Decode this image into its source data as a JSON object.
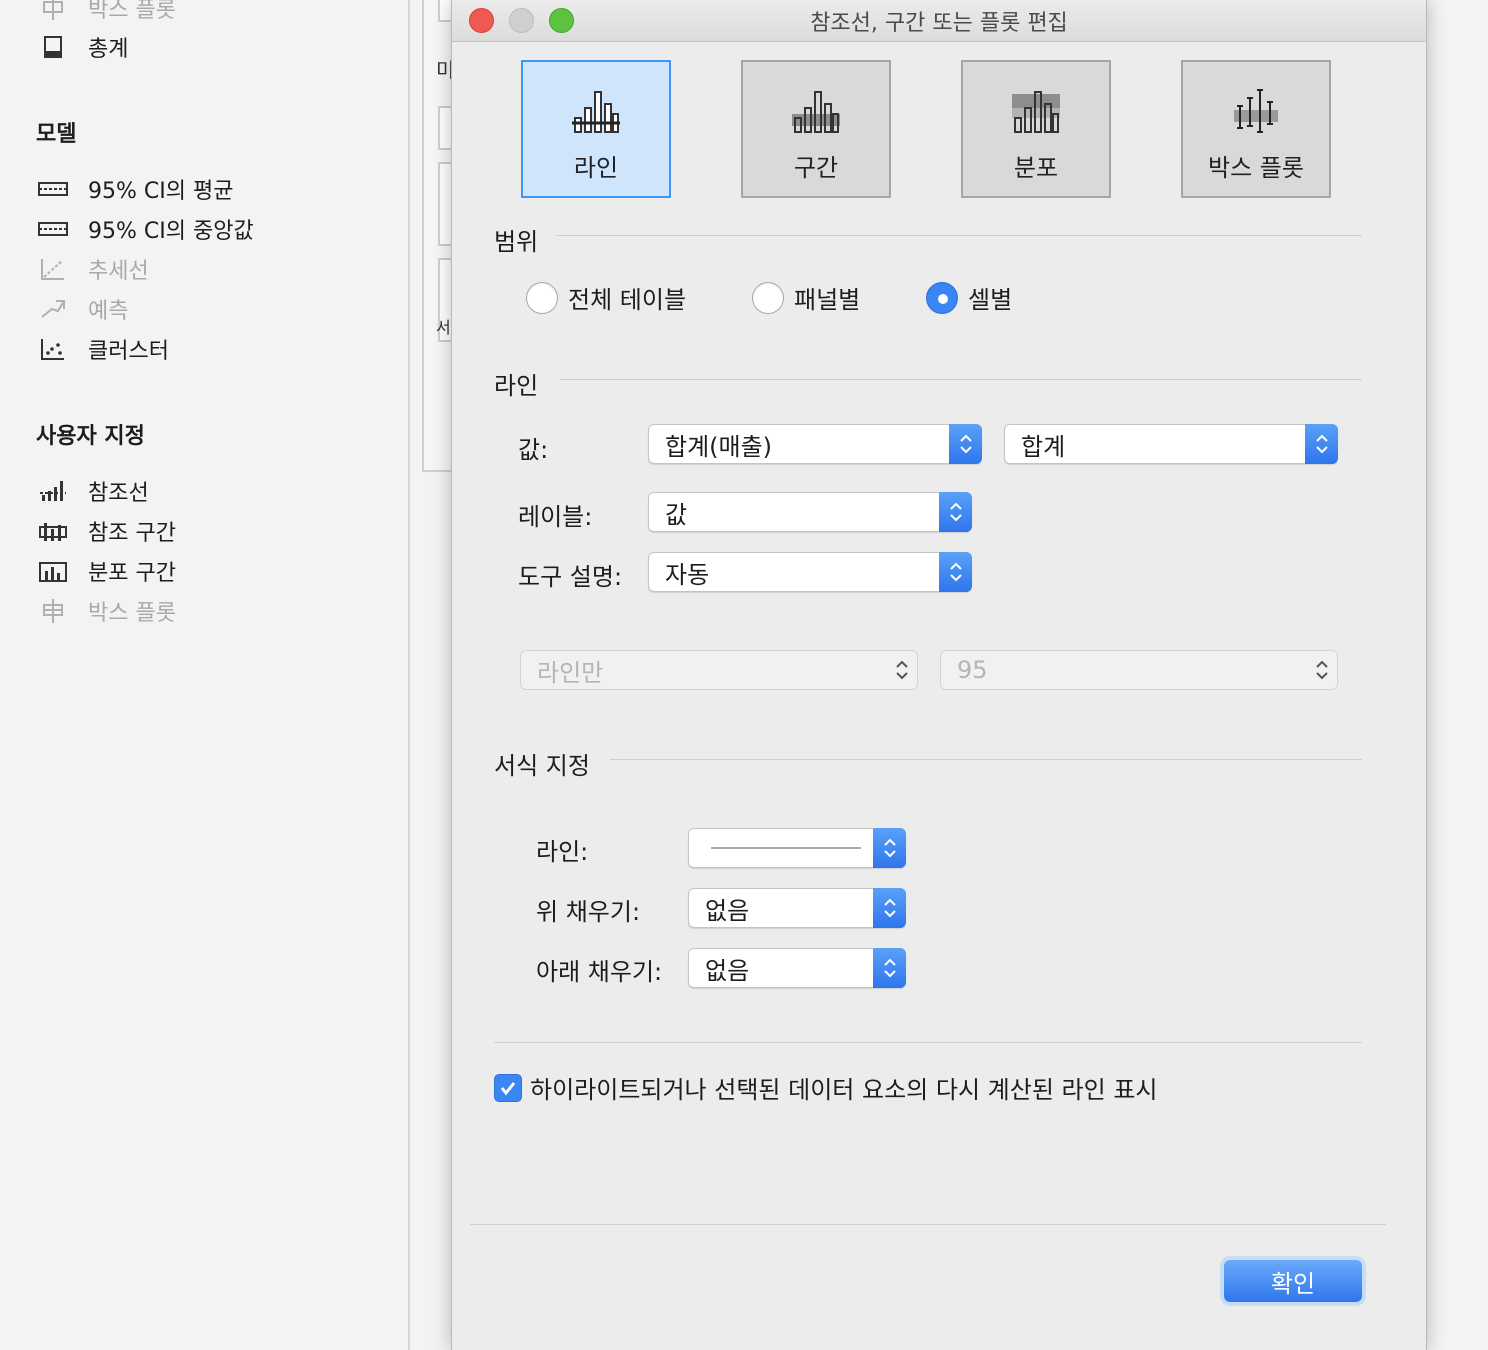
{
  "left_pane": {
    "top_partial_item": "박스 플롯",
    "top_item": "총계",
    "model": {
      "title": "모델",
      "items": [
        {
          "label": "95% CI의 평균",
          "icon": "ci-band-icon",
          "enabled": true
        },
        {
          "label": "95% CI의 중앙값",
          "icon": "ci-band-icon",
          "enabled": true
        },
        {
          "label": "추세선",
          "icon": "trend-line-icon",
          "enabled": false
        },
        {
          "label": "예측",
          "icon": "forecast-icon",
          "enabled": false
        },
        {
          "label": "클러스터",
          "icon": "cluster-icon",
          "enabled": true
        }
      ]
    },
    "custom": {
      "title": "사용자 지정",
      "items": [
        {
          "label": "참조선",
          "icon": "reference-line-icon",
          "enabled": true
        },
        {
          "label": "참조 구간",
          "icon": "reference-band-icon",
          "enabled": true
        },
        {
          "label": "분포 구간",
          "icon": "distribution-band-icon",
          "enabled": true
        },
        {
          "label": "박스 플롯",
          "icon": "box-plot-icon",
          "enabled": false
        }
      ]
    }
  },
  "behind_window": {
    "fragment_top": "미",
    "fragment_mid": "서"
  },
  "dialog": {
    "title": "참조선, 구간 또는 플롯 편집",
    "type_buttons": [
      {
        "label": "라인",
        "selected": true
      },
      {
        "label": "구간",
        "selected": false
      },
      {
        "label": "분포",
        "selected": false
      },
      {
        "label": "박스 플롯",
        "selected": false
      }
    ],
    "scope": {
      "title": "범위",
      "options": [
        {
          "label": "전체 테이블",
          "checked": false
        },
        {
          "label": "패널별",
          "checked": false
        },
        {
          "label": "셀별",
          "checked": true
        }
      ]
    },
    "line_section": {
      "title": "라인",
      "value_label": "값:",
      "value_field": "합계(매출)",
      "value_aggregation": "합계",
      "label_label": "레이블:",
      "label_value": "값",
      "tooltip_label": "도구 설명:",
      "tooltip_value": "자동",
      "ci_mode": "라인만",
      "ci_percent": "95"
    },
    "format": {
      "title": "서식 지정",
      "line_label": "라인:",
      "fill_above_label": "위 채우기:",
      "fill_above_value": "없음",
      "fill_below_label": "아래 채우기:",
      "fill_below_value": "없음"
    },
    "recalc_checkbox": {
      "label": "하이라이트되거나 선택된 데이터 요소의 다시 계산된 라인 표시",
      "checked": true
    },
    "ok_button": "확인"
  },
  "colors": {
    "accent": "#3b86f5",
    "selected_tile": "#cfe5fc",
    "close": "#ee5a52",
    "maximize": "#5dc23f"
  }
}
